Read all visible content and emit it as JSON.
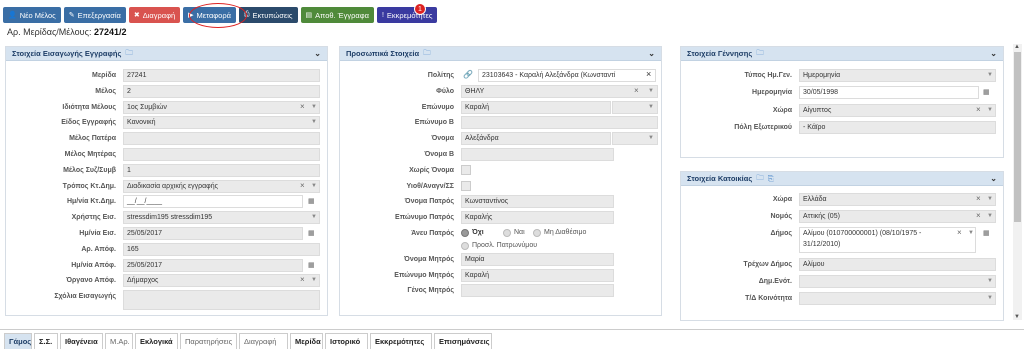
{
  "toolbar": [
    {
      "label": "Νέο Μέλος",
      "icon": "user-plus-icon",
      "color": "#3a6ea5"
    },
    {
      "label": "Επεξεργασία",
      "icon": "edit-icon",
      "color": "#3a6ea5"
    },
    {
      "label": "Διαγραφή",
      "icon": "delete-icon",
      "color": "#d9534f"
    },
    {
      "label": "Μεταφορά",
      "icon": "play-icon",
      "color": "#3a6ea5"
    },
    {
      "label": "Εκτυπώσεις",
      "icon": "print-icon",
      "color": "#2b4a6b"
    },
    {
      "label": "Αποθ. Έγγραφα",
      "icon": "save-doc-icon",
      "color": "#4f8a3a"
    },
    {
      "label": "Εκκρεμότητες",
      "icon": "alert-icon",
      "color": "#3a3aa0"
    }
  ],
  "badge": "1",
  "header": {
    "label": "Αρ. Μερίδας/Μέλους:",
    "value": "27241/2"
  },
  "reg": {
    "title": "Στοιχεία Εισαγωγής Εγγραφής",
    "rows": [
      {
        "label": "Μερίδα",
        "value": "27241"
      },
      {
        "label": "Μέλος",
        "value": "2"
      },
      {
        "label": "Ιδιότητα Μέλους",
        "value": "1ος Συμβιών"
      },
      {
        "label": "Είδος Εγγραφής",
        "value": "Κανονική"
      },
      {
        "label": "Μέλος Πατέρα",
        "value": ""
      },
      {
        "label": "Μέλος Μητέρας",
        "value": ""
      },
      {
        "label": "Μέλος Συζ/Συμβ",
        "value": "1"
      },
      {
        "label": "Τρόπος Κτ.Δημ.",
        "value": "Διαδικασία αρχικής εγγραφής"
      },
      {
        "label": "Ημ/νία Κτ.Δημ.",
        "value": "__/__/____"
      },
      {
        "label": "Χρήστης Εισ.",
        "value": "stressdim195 stressdim195"
      },
      {
        "label": "Ημ/νία Εισ.",
        "value": "25/05/2017"
      },
      {
        "label": "Αρ. Απόφ.",
        "value": "165"
      },
      {
        "label": "Ημ/νία Απόφ.",
        "value": "25/05/2017"
      },
      {
        "label": "Όργανο Απόφ.",
        "value": "Δήμαρχος"
      },
      {
        "label": "Σχόλια Εισαγωγής",
        "value": ""
      }
    ]
  },
  "personal": {
    "title": "Προσωπικά Στοιχεία",
    "rows": [
      {
        "label": "Πολίτης",
        "value": "23103643 - Καραλή Αλεξάνδρα (Κωνσταντί"
      },
      {
        "label": "Φύλο",
        "value": "ΘΗΛΥ"
      },
      {
        "label": "Επώνυμο",
        "value": "Καραλή"
      },
      {
        "label": "Επώνυμο Β",
        "value": ""
      },
      {
        "label": "Όνομα",
        "value": "Αλεξάνδρα"
      },
      {
        "label": "Όνομα Β",
        "value": ""
      },
      {
        "label": "Χωρίς Όνομα",
        "value": ""
      },
      {
        "label": "Υιοθ/Αναγν/ΣΣ",
        "value": ""
      },
      {
        "label": "Όνομα Πατρός",
        "value": "Κωνσταντίνος"
      },
      {
        "label": "Επώνυμο Πατρός",
        "value": "Καραλής"
      },
      {
        "label": "Άνευ Πατρός",
        "value": ""
      },
      {
        "label": "Όνομα Μητρός",
        "value": "Μαρία"
      },
      {
        "label": "Επώνυμο Μητρός",
        "value": "Καραλή"
      },
      {
        "label": "Γένος Μητρός",
        "value": ""
      }
    ],
    "radios": [
      "Όχι",
      "Ναι",
      "Μη Διαθέσιμο",
      "Προσλ. Πατρωνύμου"
    ]
  },
  "birth": {
    "title": "Στοιχεία Γέννησης",
    "rows": [
      {
        "label": "Τύπος Ημ.Γεν.",
        "value": "Ημερομηνία"
      },
      {
        "label": "Ημερομηνία",
        "value": "30/05/1998"
      },
      {
        "label": "Χώρα",
        "value": "Αίγυπτος"
      },
      {
        "label": "Πόλη Εξωτερικού",
        "value": "- Κάϊρο"
      }
    ]
  },
  "residence": {
    "title": "Στοιχεία Κατοικίας",
    "rows": [
      {
        "label": "Χώρα",
        "value": "Ελλάδα"
      },
      {
        "label": "Νομός",
        "value": "Αττικής (05)"
      },
      {
        "label": "Δήμος",
        "value": "Αλίμου (010700000001) (08/10/1975 -"
      },
      {
        "label": "Δήμος2",
        "value": "31/12/2010)"
      },
      {
        "label": "Τρέχων Δήμος",
        "value": "Αλίμου"
      },
      {
        "label": "Δημ.Ενότ.",
        "value": ""
      },
      {
        "label": "Τ/Δ Κοινότητα",
        "value": ""
      }
    ]
  },
  "tabs": [
    "Γάμος",
    "Σ.Σ.",
    "Ιθαγένεια",
    "Μ.Αρ.",
    "Εκλογικά",
    "Παρατηρήσεις",
    "Διαγραφή",
    "Μερίδα",
    "Ιστορικό",
    "Εκκρεμότητες",
    "Επισημάνσεις"
  ]
}
